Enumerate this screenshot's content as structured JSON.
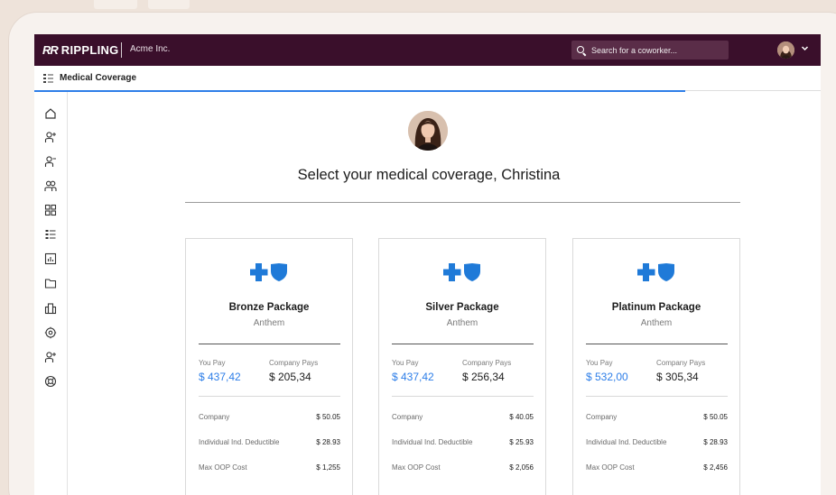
{
  "app": {
    "logo_text": "RIPPLING",
    "logo_mark": "RR",
    "company": "Acme Inc.",
    "search_placeholder": "Search for a coworker..."
  },
  "subbar": {
    "title": "Medical Coverage"
  },
  "colors": {
    "topbar": "#3a0f2b",
    "accent": "#2d7ee8",
    "insurer_blue": "#1f7ad8"
  },
  "sidebar_icons": [
    "home-icon",
    "add-person-icon",
    "remove-person-icon",
    "people-icon",
    "apps-grid-icon",
    "list-icon",
    "report-icon",
    "folder-icon",
    "building-icon",
    "settings-icon",
    "person-plus-icon",
    "support-icon"
  ],
  "main": {
    "heading": "Select your medical coverage, Christina"
  },
  "plans": [
    {
      "name": "Bronze Package",
      "carrier": "Anthem",
      "you_pay_label": "You Pay",
      "you_pay": "$ 437,42",
      "company_pays_label": "Company Pays",
      "company_pays": "$ 205,34",
      "rows": [
        {
          "label": "Company",
          "value": "$ 50.05"
        },
        {
          "label": "Individual Ind. Deductible",
          "value": "$ 28.93"
        },
        {
          "label": "Max OOP Cost",
          "value": "$ 1,255"
        }
      ]
    },
    {
      "name": "Silver Package",
      "carrier": "Anthem",
      "you_pay_label": "You Pay",
      "you_pay": "$ 437,42",
      "company_pays_label": "Company Pays",
      "company_pays": "$ 256,34",
      "rows": [
        {
          "label": "Company",
          "value": "$ 40.05"
        },
        {
          "label": "Individual Ind. Deductible",
          "value": "$ 25.93"
        },
        {
          "label": "Max OOP Cost",
          "value": "$ 2,056"
        }
      ]
    },
    {
      "name": "Platinum Package",
      "carrier": "Anthem",
      "you_pay_label": "You Pay",
      "you_pay": "$ 532,00",
      "company_pays_label": "Company Pays",
      "company_pays": "$ 305,34",
      "rows": [
        {
          "label": "Company",
          "value": "$ 50.05"
        },
        {
          "label": "Individual Ind. Deductible",
          "value": "$ 28.93"
        },
        {
          "label": "Max OOP Cost",
          "value": "$ 2,456"
        }
      ]
    }
  ]
}
